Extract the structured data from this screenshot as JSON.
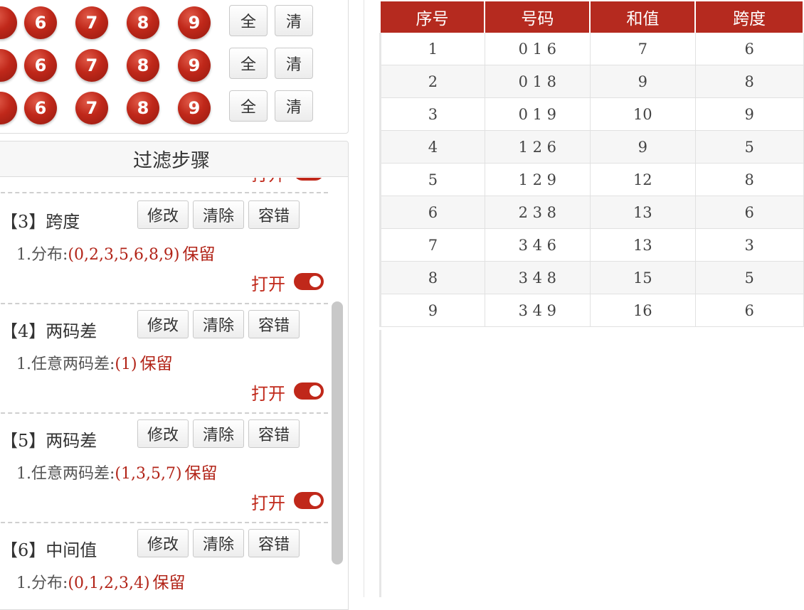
{
  "picker": {
    "rows": [
      {
        "partial": "",
        "digits": [
          "6",
          "7",
          "8",
          "9"
        ],
        "all_label": "全",
        "clear_label": "清"
      },
      {
        "partial": "",
        "digits": [
          "6",
          "7",
          "8",
          "9"
        ],
        "all_label": "全",
        "clear_label": "清"
      },
      {
        "partial": "",
        "digits": [
          "6",
          "7",
          "8",
          "9"
        ],
        "all_label": "全",
        "clear_label": "清"
      }
    ]
  },
  "filter_panel": {
    "title": "过滤步骤",
    "prev_toggle_label": "打开",
    "steps": [
      {
        "title": "【3】跨度",
        "edit": "修改",
        "clear": "清除",
        "tolerance": "容错",
        "cond_prefix": "1.分布:",
        "cond_value": "(0,2,3,5,6,8,9)",
        "keep": "保留",
        "toggle_label": "打开"
      },
      {
        "title": "【4】两码差",
        "edit": "修改",
        "clear": "清除",
        "tolerance": "容错",
        "cond_prefix": "1.任意两码差:",
        "cond_value": "(1)",
        "keep": "保留",
        "toggle_label": "打开"
      },
      {
        "title": "【5】两码差",
        "edit": "修改",
        "clear": "清除",
        "tolerance": "容错",
        "cond_prefix": "1.任意两码差:",
        "cond_value": "(1,3,5,7)",
        "keep": "保留",
        "toggle_label": "打开"
      },
      {
        "title": "【6】中间值",
        "edit": "修改",
        "clear": "清除",
        "tolerance": "容错",
        "cond_prefix": "1.分布:",
        "cond_value": "(0,1,2,3,4)",
        "keep": "保留",
        "toggle_label": ""
      }
    ]
  },
  "table": {
    "headers": [
      "序号",
      "号码",
      "和值",
      "跨度"
    ],
    "rows": [
      [
        "1",
        "0 1 6",
        "7",
        "6"
      ],
      [
        "2",
        "0 1 8",
        "9",
        "8"
      ],
      [
        "3",
        "0 1 9",
        "10",
        "9"
      ],
      [
        "4",
        "1 2 6",
        "9",
        "5"
      ],
      [
        "5",
        "1 2 9",
        "12",
        "8"
      ],
      [
        "6",
        "2 3 8",
        "13",
        "6"
      ],
      [
        "7",
        "3 4 6",
        "13",
        "3"
      ],
      [
        "8",
        "3 4 8",
        "15",
        "5"
      ],
      [
        "9",
        "3 4 9",
        "16",
        "6"
      ]
    ]
  },
  "colors": {
    "accent_red": "#b52a1f",
    "ball_red": "#c0281a",
    "toggle_on": "#c0281a"
  },
  "icons": {
    "toggle": "toggle-switch-icon"
  }
}
